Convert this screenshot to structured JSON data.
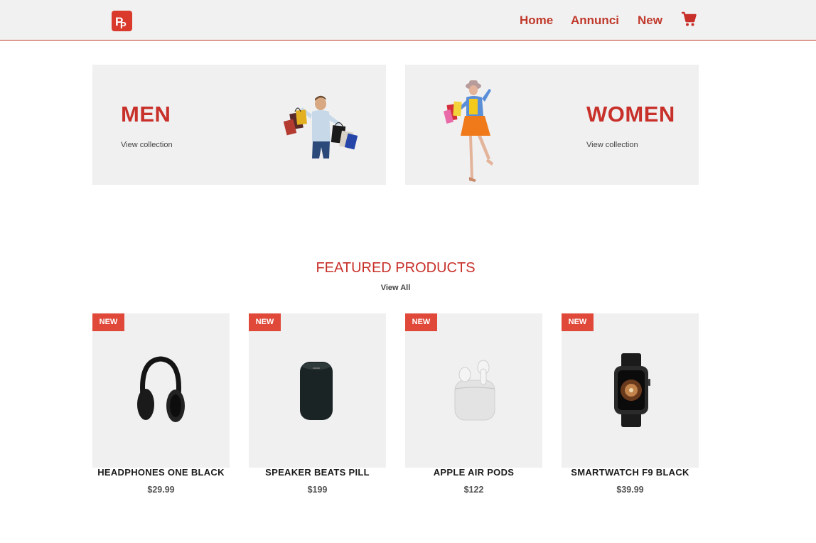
{
  "header": {
    "logo_icon": "pp-logo-icon",
    "nav": [
      {
        "label": "Home"
      },
      {
        "label": "Annunci"
      },
      {
        "label": "New"
      }
    ],
    "cart_icon": "cart-icon"
  },
  "banners": {
    "men": {
      "title": "MEN",
      "link": "View collection"
    },
    "women": {
      "title": "WOMEN",
      "link": "View collection"
    }
  },
  "featured": {
    "title": "FEATURED PRODUCTS",
    "view_all": "View All",
    "products": [
      {
        "badge": "NEW",
        "name": "HEADPHONES ONE BLACK",
        "price": "$29.99",
        "icon": "headphones-icon"
      },
      {
        "badge": "NEW",
        "name": "SPEAKER BEATS PILL",
        "price": "$199",
        "icon": "speaker-icon"
      },
      {
        "badge": "NEW",
        "name": "APPLE AIR PODS",
        "price": "$122",
        "icon": "airpods-icon"
      },
      {
        "badge": "NEW",
        "name": "SMARTWATCH F9 BLACK",
        "price": "$39.99",
        "icon": "smartwatch-icon"
      }
    ]
  },
  "colors": {
    "accent": "#c8302a",
    "header_bg": "#f1f1f2",
    "card_bg": "#f0f0f1",
    "badge_bg": "#e0493a"
  }
}
